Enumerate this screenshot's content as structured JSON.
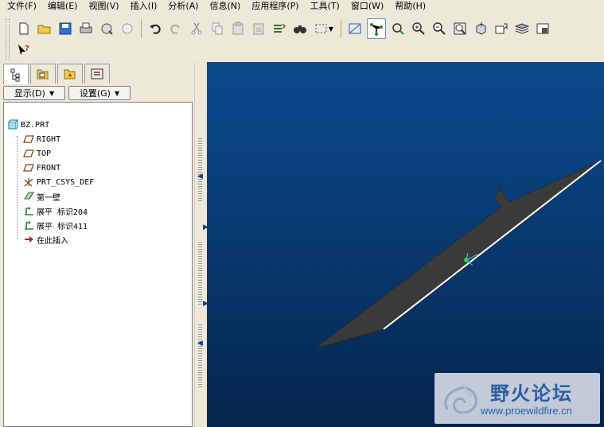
{
  "menubar": {
    "items": [
      "文件(F)",
      "编辑(E)",
      "视图(V)",
      "插入(I)",
      "分析(A)",
      "信息(N)",
      "应用程序(P)",
      "工具(T)",
      "窗口(W)",
      "帮助(H)"
    ]
  },
  "toolbar": {
    "icons": [
      "new-file-icon",
      "open-folder-icon",
      "save-icon",
      "print-icon",
      "send-mail-icon",
      "cut-icon",
      "copy-icon",
      "paste-icon",
      "undo-icon",
      "redo-icon",
      "search-icon",
      "zoom-in-icon",
      "zoom-out-icon",
      "refit-icon",
      "layers-icon",
      "whats-this-icon"
    ]
  },
  "tree_toolbar": {
    "show_label": "显示(D)",
    "settings_label": "设置(G)"
  },
  "model_tree": {
    "root": "BZ.PRT",
    "items": [
      "RIGHT",
      "TOP",
      "FRONT",
      "PRT_CSYS_DEF",
      "第一壁",
      "展平 标识204",
      "展平 标识411",
      "在此插入"
    ]
  },
  "watermark": {
    "title": "野火论坛",
    "url": "www.proewildfire.cn"
  },
  "colors": {
    "viewport_top": "#0a4a8c",
    "viewport_bottom": "#05254c",
    "accent": "#2d5da8"
  }
}
